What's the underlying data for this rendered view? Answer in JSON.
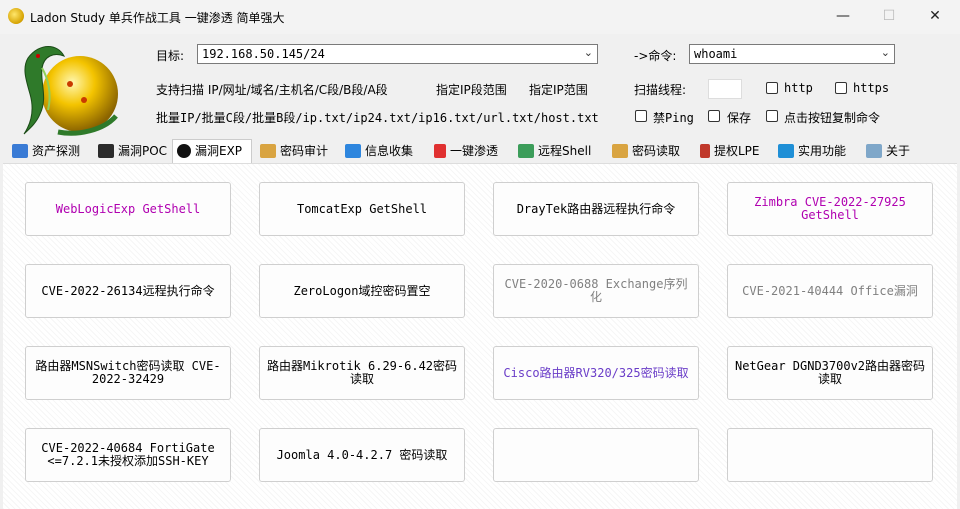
{
  "window": {
    "title": "Ladon Study 单兵作战工具 一键渗透 简单强大",
    "minimize": "—",
    "maximize": "☐",
    "close": "✕"
  },
  "form": {
    "target_label": "目标:",
    "target_value": "192.168.50.145/24",
    "command_label": "->命令:",
    "command_value": "whoami",
    "scan_support_text": "支持扫描 IP/网址/域名/主机名/C段/B段/A段",
    "ip_range_label": "指定IP段范围",
    "ip_scope_label": "指定IP范围",
    "threads_label": "扫描线程:",
    "threads_value": "",
    "batch_text": "批量IP/批量C段/批量B段/ip.txt/ip24.txt/ip16.txt/url.txt/host.txt",
    "checkboxes": {
      "http": "http",
      "https": "https",
      "no_ping": "禁Ping",
      "save": "保存",
      "copy_cmd": "点击按钮复制命令"
    }
  },
  "tabs": [
    {
      "label": "资产探测",
      "icon": "monitor-icon"
    },
    {
      "label": "漏洞POC",
      "icon": "bug-icon"
    },
    {
      "label": "漏洞EXP",
      "icon": "target-icon",
      "active": true
    },
    {
      "label": "密码审计",
      "icon": "users-icon"
    },
    {
      "label": "信息收集",
      "icon": "network-icon"
    },
    {
      "label": "一键渗透",
      "icon": "s-logo-icon"
    },
    {
      "label": "远程Shell",
      "icon": "remote-icon"
    },
    {
      "label": "密码读取",
      "icon": "users-key-icon"
    },
    {
      "label": "提权LPE",
      "icon": "pen-icon"
    },
    {
      "label": "实用功能",
      "icon": "arrows-icon"
    },
    {
      "label": "关于",
      "icon": "speaker-icon"
    }
  ],
  "buttons": [
    {
      "label": "WebLogicExp GetShell",
      "color": "#b000b0"
    },
    {
      "label": "TomcatExp GetShell",
      "color": "#000000"
    },
    {
      "label": "DrayTek路由器远程执行命令",
      "color": "#000000"
    },
    {
      "label": "Zimbra CVE-2022-27925 GetShell",
      "color": "#b000b0"
    },
    {
      "label": "CVE-2022-26134远程执行命令",
      "color": "#000000"
    },
    {
      "label": "ZeroLogon域控密码置空",
      "color": "#000000"
    },
    {
      "label": "CVE-2020-0688 Exchange序列化",
      "color": "#808080"
    },
    {
      "label": "CVE-2021-40444 Office漏洞",
      "color": "#808080"
    },
    {
      "label": "路由器MSNSwitch密码读取 CVE-2022-32429",
      "color": "#000000"
    },
    {
      "label": "路由器Mikrotik 6.29-6.42密码读取",
      "color": "#000000"
    },
    {
      "label": "Cisco路由器RV320/325密码读取",
      "color": "#6a3dc8"
    },
    {
      "label": "NetGear DGND3700v2路由器密码读取",
      "color": "#000000"
    },
    {
      "label": "CVE-2022-40684 FortiGate <=7.2.1未授权添加SSH-KEY",
      "color": "#000000"
    },
    {
      "label": "Joomla 4.0-4.2.7 密码读取",
      "color": "#000000"
    },
    {
      "label": "",
      "color": "#000000"
    },
    {
      "label": "",
      "color": "#000000"
    }
  ]
}
